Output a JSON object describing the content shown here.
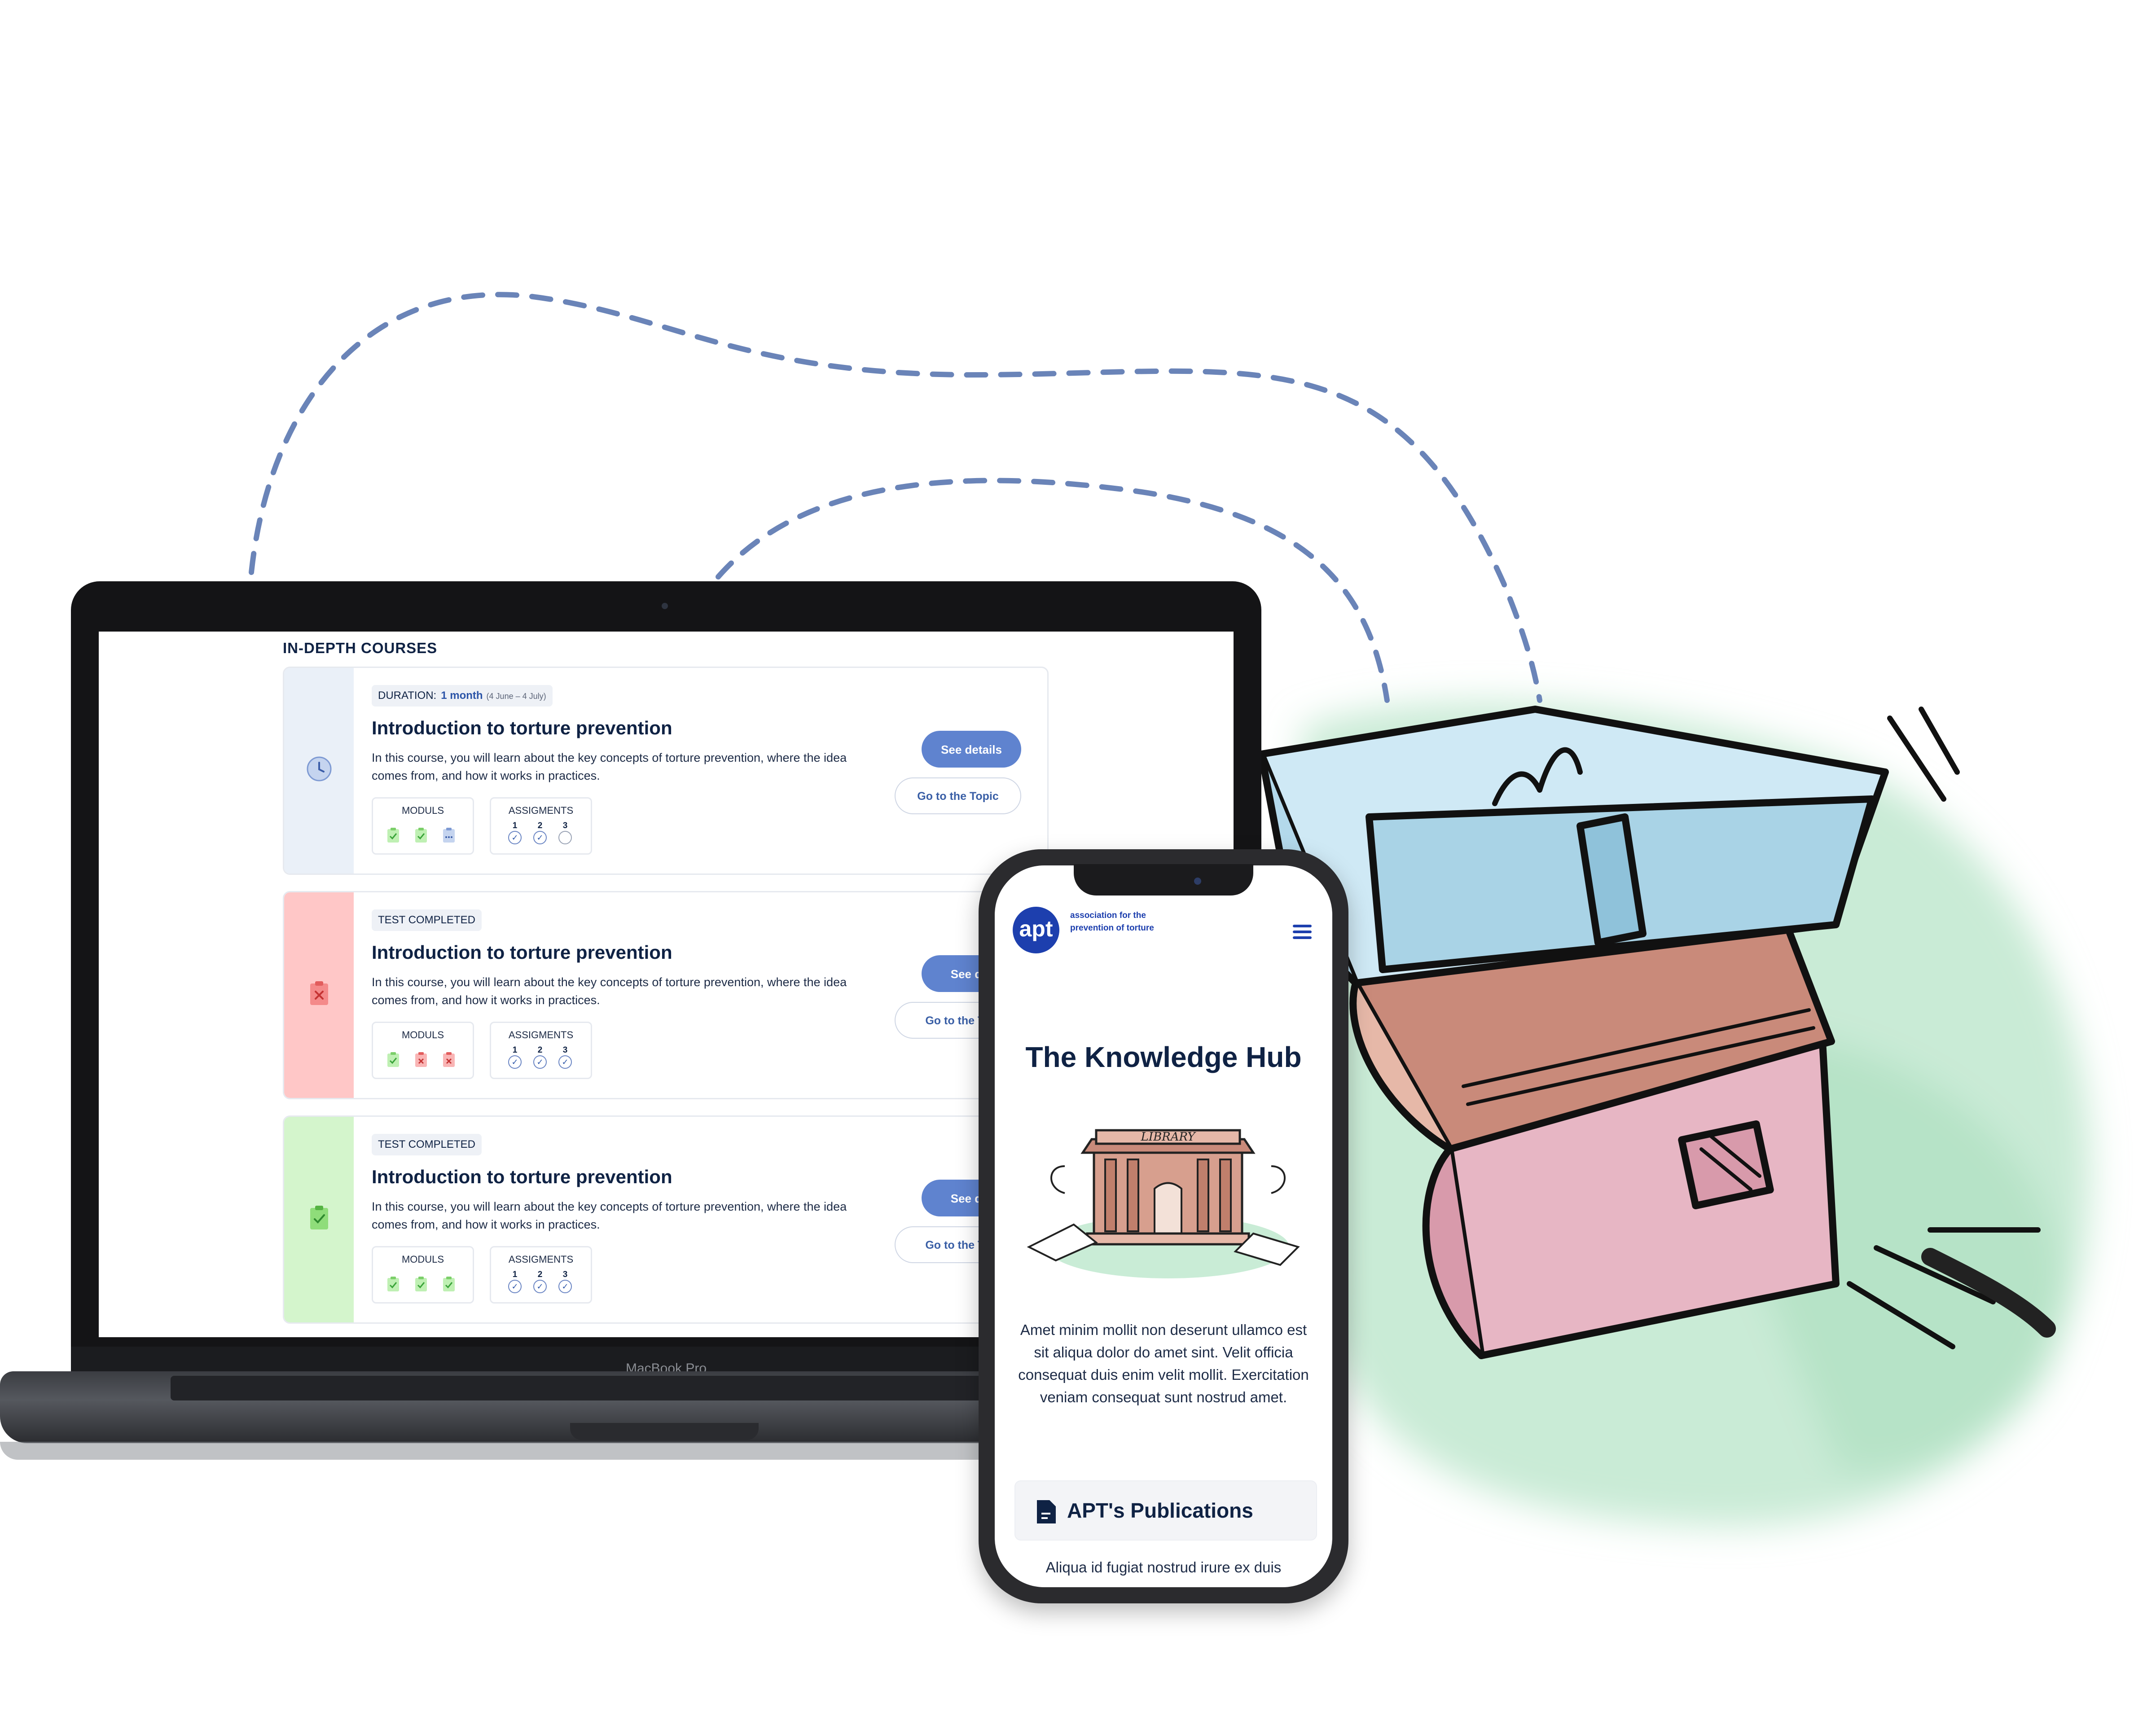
{
  "laptop": {
    "brand": "MacBook Pro",
    "section_title": "IN-DEPTH COURSES",
    "courses": [
      {
        "status": "in-progress",
        "pill_label": "DURATION:",
        "duration": "1 month",
        "dates": "(4 June – 4 July)",
        "title": "Introduction to torture prevention",
        "description": "In this course, you will learn about the key concepts of torture prevention, where the idea comes from, and how it works in practices.",
        "modules_label": "MODULS",
        "modules": [
          "done",
          "done",
          "pending"
        ],
        "assignments_label": "ASSIGMENTS",
        "assignments": [
          {
            "num": "1",
            "done": true
          },
          {
            "num": "2",
            "done": true
          },
          {
            "num": "3",
            "done": false
          }
        ],
        "primary_button": "See details",
        "secondary_button": "Go to the Topic"
      },
      {
        "status": "failed",
        "pill_label": "TEST COMPLETED",
        "title": "Introduction to torture prevention",
        "description": "In this course, you will learn about the key concepts of torture prevention, where the idea comes from, and how it works in practices.",
        "modules_label": "MODULS",
        "modules": [
          "done",
          "failed",
          "failed"
        ],
        "assignments_label": "ASSIGMENTS",
        "assignments": [
          {
            "num": "1",
            "done": true
          },
          {
            "num": "2",
            "done": true
          },
          {
            "num": "3",
            "done": true
          }
        ],
        "primary_button": "See det",
        "secondary_button": "Go to the To"
      },
      {
        "status": "passed",
        "pill_label": "TEST COMPLETED",
        "title": "Introduction to torture prevention",
        "description": "In this course, you will learn about the key concepts of torture prevention, where the idea comes from, and how it works in practices.",
        "modules_label": "MODULS",
        "modules": [
          "done",
          "done",
          "done"
        ],
        "assignments_label": "ASSIGMENTS",
        "assignments": [
          {
            "num": "1",
            "done": true
          },
          {
            "num": "2",
            "done": true
          },
          {
            "num": "3",
            "done": true
          }
        ],
        "primary_button": "See det",
        "secondary_button": "Go to the To"
      }
    ]
  },
  "phone": {
    "logo_text": "apt",
    "tagline": "association for the prevention of torture",
    "menu_icon": "hamburger-icon",
    "hub_title": "The Knowledge Hub",
    "illustration_caption": "LIBRARY",
    "hub_text": "Amet minim mollit non deserunt ullamco est sit aliqua dolor do amet sint. Velit officia consequat duis enim velit mollit. Exercitation veniam consequat sunt nostrud amet.",
    "publications_title": "APT's Publications",
    "publications_sub": "Aliqua id fugiat nostrud irure ex duis"
  },
  "colors": {
    "navy": "#0f2244",
    "accent_blue": "#5f83cf",
    "brand_blue": "#1d3fae",
    "strip_progress": "#eaf0f8",
    "strip_failed": "#ffc7c7",
    "strip_passed": "#d4f5cc",
    "dashed_line": "#6a84b8"
  }
}
